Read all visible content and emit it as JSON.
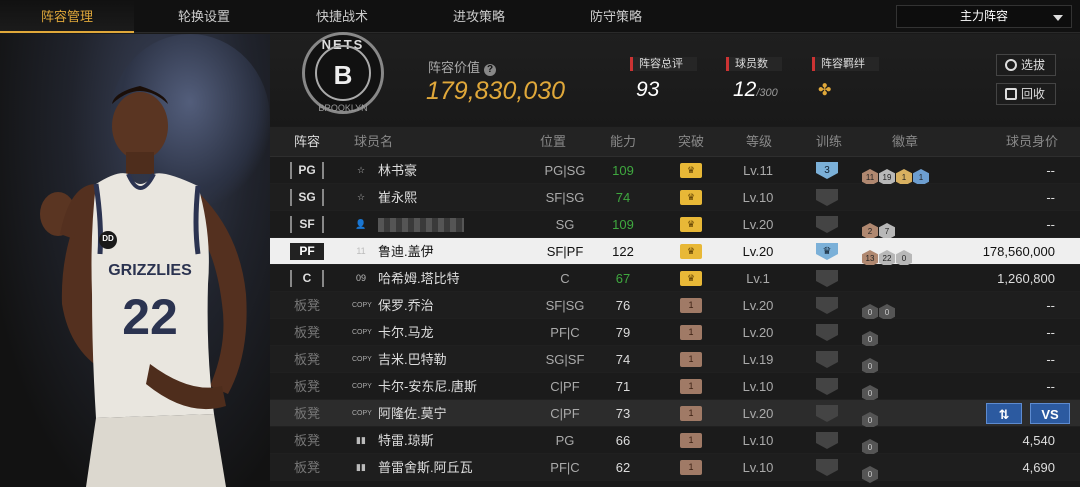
{
  "nav": {
    "tabs": [
      {
        "label": "阵容管理"
      },
      {
        "label": "轮换设置"
      },
      {
        "label": "快捷战术"
      },
      {
        "label": "进攻策略"
      },
      {
        "label": "防守策略"
      }
    ],
    "lineup_select": "主力阵容"
  },
  "player": {
    "jersey_team": "GRIZZLIES",
    "jersey_number": "22",
    "patch": "DD"
  },
  "team": {
    "logo_text": "NETS",
    "logo_letter": "B",
    "logo_sub": "BROOKLYN"
  },
  "header": {
    "value_label": "阵容价值",
    "help_icon": "?",
    "value": "179,830,030",
    "rating_label": "阵容总评",
    "rating": "93",
    "count_label": "球员数",
    "count": "12",
    "count_max": "/300",
    "bond_label": "阵容羁绊",
    "select_button": "选拔",
    "recycle_button": "回收"
  },
  "table": {
    "headers": [
      "阵容",
      "球员名",
      "位置",
      "能力",
      "突破",
      "等级",
      "训练",
      "徽章",
      "球员身价"
    ],
    "rows": [
      {
        "slot": "PG",
        "badge": "☆",
        "name": "林书豪",
        "position": "PG|SG",
        "ability": "109",
        "ability_green": true,
        "breakthrough": "♛",
        "break_type": "gold",
        "level": "Lv.11",
        "train": "3",
        "train_on": true,
        "medals": [
          {
            "v": "11",
            "c": "bronze"
          },
          {
            "v": "19",
            "c": "silver"
          },
          {
            "v": "1",
            "c": "gold"
          },
          {
            "v": "1",
            "c": "blue"
          }
        ],
        "worth": "--"
      },
      {
        "slot": "SG",
        "badge": "☆",
        "name": "崔永熙",
        "position": "SF|SG",
        "ability": "74",
        "ability_green": true,
        "breakthrough": "♛",
        "break_type": "gold",
        "level": "Lv.10",
        "train": "",
        "train_on": false,
        "medals": [],
        "worth": "--"
      },
      {
        "slot": "SF",
        "badge": "👤",
        "name": "",
        "blurred": true,
        "position": "SG",
        "ability": "109",
        "ability_green": true,
        "breakthrough": "♛",
        "break_type": "gold",
        "level": "Lv.20",
        "train": "",
        "train_on": false,
        "medals": [
          {
            "v": "2",
            "c": "bronze"
          },
          {
            "v": "7",
            "c": "silver"
          }
        ],
        "worth": "--"
      },
      {
        "slot": "PF",
        "badge": "11",
        "name": "鲁迪.盖伊",
        "position": "SF|PF",
        "ability": "122",
        "ability_green": false,
        "breakthrough": "♛",
        "break_type": "gold",
        "level": "Lv.20",
        "train": "♛",
        "train_on": true,
        "medals": [
          {
            "v": "13",
            "c": "bronze"
          },
          {
            "v": "22",
            "c": "silver"
          },
          {
            "v": "0",
            "c": "silver"
          }
        ],
        "worth": "178,560,000",
        "selected": true
      },
      {
        "slot": "C",
        "badge": "09",
        "name": "哈希姆.塔比特",
        "position": "C",
        "ability": "67",
        "ability_green": true,
        "breakthrough": "♛",
        "break_type": "gold",
        "level": "Lv.1",
        "train": "",
        "train_on": false,
        "medals": [],
        "worth": "1,260,800"
      },
      {
        "slot": "板凳",
        "bench": true,
        "badge": "COPY",
        "name": "保罗.乔治",
        "position": "SF|SG",
        "ability": "76",
        "ability_green": false,
        "breakthrough": "1",
        "break_type": "bronze",
        "level": "Lv.20",
        "train": "",
        "train_on": false,
        "medals": [
          {
            "v": "0",
            "c": "empty"
          },
          {
            "v": "0",
            "c": "empty"
          }
        ],
        "worth": "--"
      },
      {
        "slot": "板凳",
        "bench": true,
        "badge": "COPY",
        "name": "卡尔.马龙",
        "position": "PF|C",
        "ability": "79",
        "ability_green": false,
        "breakthrough": "1",
        "break_type": "bronze",
        "level": "Lv.20",
        "train": "",
        "train_on": false,
        "medals": [
          {
            "v": "0",
            "c": "empty"
          }
        ],
        "worth": "--"
      },
      {
        "slot": "板凳",
        "bench": true,
        "badge": "COPY",
        "name": "吉米.巴特勒",
        "position": "SG|SF",
        "ability": "74",
        "ability_green": false,
        "breakthrough": "1",
        "break_type": "bronze",
        "level": "Lv.19",
        "train": "",
        "train_on": false,
        "medals": [
          {
            "v": "0",
            "c": "empty"
          }
        ],
        "worth": "--"
      },
      {
        "slot": "板凳",
        "bench": true,
        "badge": "COPY",
        "name": "卡尔-安东尼.唐斯",
        "position": "C|PF",
        "ability": "71",
        "ability_green": false,
        "breakthrough": "1",
        "break_type": "bronze",
        "level": "Lv.10",
        "train": "",
        "train_on": false,
        "medals": [
          {
            "v": "0",
            "c": "empty"
          }
        ],
        "worth": "--"
      },
      {
        "slot": "板凳",
        "bench": true,
        "badge": "COPY",
        "name": "阿隆佐.莫宁",
        "position": "C|PF",
        "ability": "73",
        "ability_green": false,
        "breakthrough": "1",
        "break_type": "bronze",
        "level": "Lv.20",
        "train": "",
        "train_on": false,
        "medals": [
          {
            "v": "0",
            "c": "empty"
          }
        ],
        "worth": "",
        "hover": true,
        "swap_button": "⇅",
        "vs_button": "VS"
      },
      {
        "slot": "板凳",
        "bench": true,
        "badge": "▮▮",
        "name": "特雷.琼斯",
        "position": "PG",
        "ability": "66",
        "ability_green": false,
        "breakthrough": "1",
        "break_type": "bronze",
        "level": "Lv.10",
        "train": "",
        "train_on": false,
        "medals": [
          {
            "v": "0",
            "c": "empty"
          }
        ],
        "worth": "4,540"
      },
      {
        "slot": "板凳",
        "bench": true,
        "badge": "▮▮",
        "name": "普雷舍斯.阿丘瓦",
        "position": "PF|C",
        "ability": "62",
        "ability_green": false,
        "breakthrough": "1",
        "break_type": "bronze",
        "level": "Lv.10",
        "train": "",
        "train_on": false,
        "medals": [
          {
            "v": "0",
            "c": "empty"
          }
        ],
        "worth": "4,690"
      }
    ]
  },
  "colors": {
    "accent": "#e0a83a",
    "ability_green": "#3fa83f",
    "selected_row": "#efefef",
    "stat_marker": "#cc3333"
  }
}
